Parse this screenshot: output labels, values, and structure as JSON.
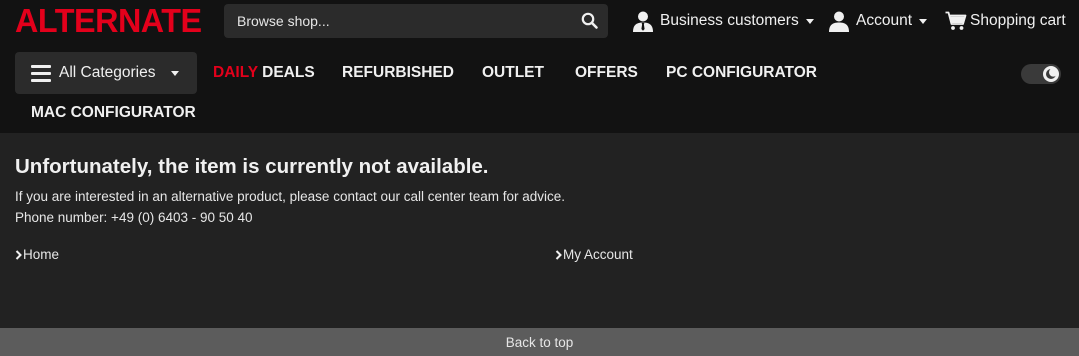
{
  "header": {
    "logo_text": "ALTERNATE",
    "brand_color": "#e3001b",
    "search": {
      "placeholder": "Browse shop..."
    },
    "top_nav": {
      "business_label": "Business customers",
      "account_label": "Account",
      "cart_label": "Shopping cart"
    },
    "categories_label": "All Categories",
    "main_nav": {
      "daily_red": "DAILY",
      "daily_rest": " DEALS",
      "refurbished": "REFURBISHED",
      "outlet": "OUTLET",
      "offers": "OFFERS",
      "pc_configurator": "PC CONFIGURATOR",
      "mac_configurator": "MAC CONFIGURATOR"
    },
    "theme_toggle": "dark-mode"
  },
  "main": {
    "title": "Unfortunately, the item is currently not available.",
    "line1": "If you are interested in an alternative product, please contact our call center team for advice.",
    "line2": "Phone number: +49 (0) 6403 - 90 50 40",
    "links": {
      "home": "Home",
      "my_account": "My Account"
    }
  },
  "footer": {
    "back_to_top": "Back to top"
  },
  "icons": {
    "search": "search-icon",
    "person": "person-icon",
    "cart": "cart-icon",
    "menu": "hamburger-icon",
    "moon": "moon-icon",
    "chevron": "chevron-right-icon"
  }
}
